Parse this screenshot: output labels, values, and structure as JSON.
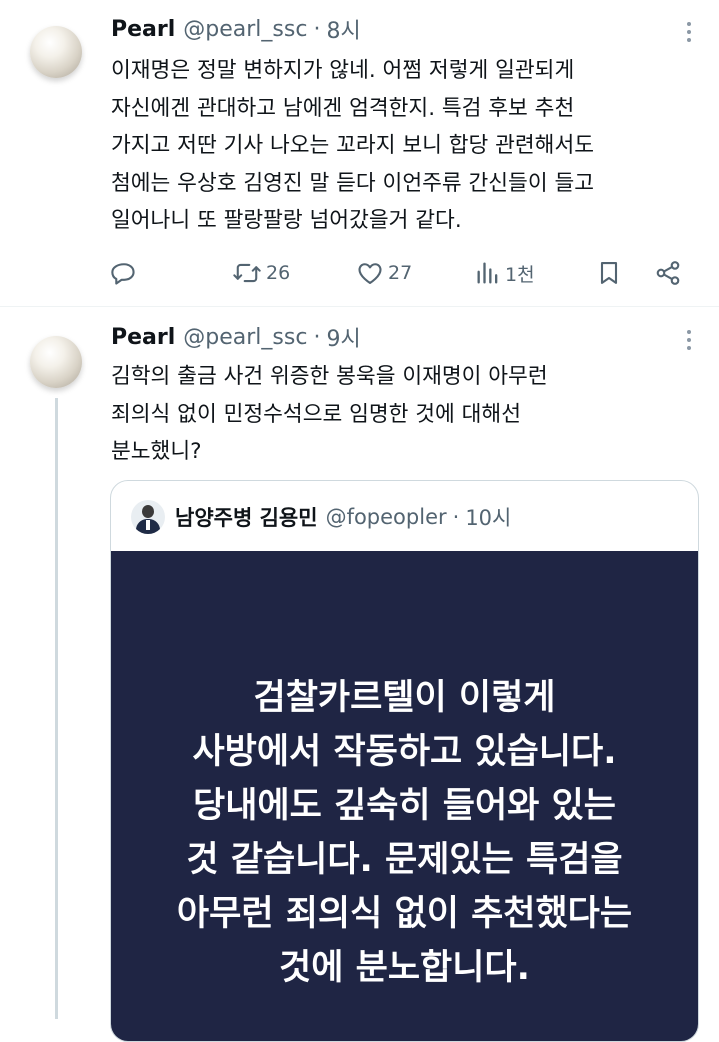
{
  "tweets": [
    {
      "author_name": "Pearl",
      "handle": "@pearl_ssc",
      "separator": "·",
      "time": "8시",
      "lines": [
        "이재명은 정말 변하지가 않네. 어쩜 저렇게 일관되게",
        "자신에겐 관대하고 남에겐 엄격한지. 특검 후보 추천",
        "가지고 저딴 기사 나오는 꼬라지 보니 합당 관련해서도",
        "첨에는 우상호 김영진 말 듣다 이언주류 간신들이 들고",
        "일어나니 또 팔랑팔랑 넘어갔을거 같다."
      ],
      "actions": {
        "reply_count": "",
        "retweet_count": "26",
        "like_count": "27",
        "views_count": "1천"
      }
    },
    {
      "author_name": "Pearl",
      "handle": "@pearl_ssc",
      "separator": "·",
      "time": "9시",
      "lines": [
        "김학의 출금 사건 위증한 봉욱을 이재명이 아무런",
        "죄의식 없이 민정수석으로 임명한 것에 대해선",
        "분노했니?"
      ],
      "quote": {
        "author_name": "남양주병 김용민",
        "handle": "@fopeopler",
        "separator": "·",
        "time": "10시",
        "image_text_lines": [
          "검찰카르텔이 이렇게",
          "사방에서 작동하고 있습니다.",
          "당내에도 깊숙히 들어와 있는",
          "것 같습니다. 문제있는 특검을",
          "아무런 죄의식 없이 추천했다는",
          "것에 분노합니다."
        ]
      }
    }
  ],
  "colors": {
    "text": "#0f1419",
    "secondary": "#536471",
    "border": "#cfd9de",
    "quote_image_bg": "#1f2544"
  },
  "icons": [
    "reply-icon",
    "retweet-icon",
    "like-icon",
    "views-icon",
    "bookmark-icon",
    "share-icon",
    "more-icon"
  ]
}
